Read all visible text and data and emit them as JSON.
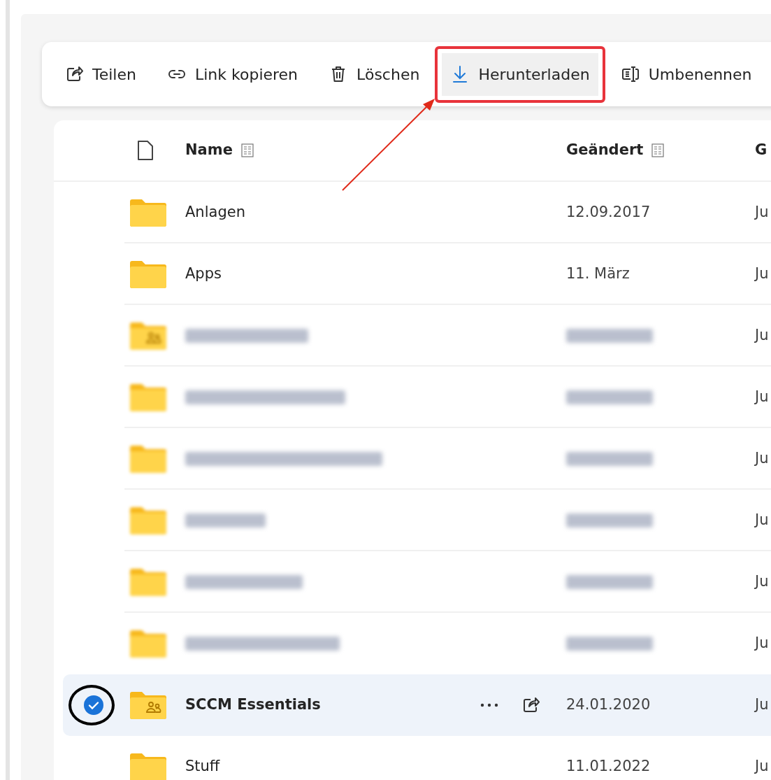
{
  "toolbar": [
    {
      "kind": "share",
      "label": "Teilen",
      "hovered": false,
      "annotated": false
    },
    {
      "kind": "link",
      "label": "Link kopieren",
      "hovered": false,
      "annotated": false
    },
    {
      "kind": "delete",
      "label": "Löschen",
      "hovered": false,
      "annotated": false
    },
    {
      "kind": "download",
      "label": "Herunterladen",
      "hovered": true,
      "annotated": true
    },
    {
      "kind": "rename",
      "label": "Umbenennen",
      "hovered": false,
      "annotated": false
    }
  ],
  "table": {
    "columns": [
      "Name",
      "Geändert",
      "G"
    ],
    "rows": [
      {
        "kind": "folder",
        "name": "Anlagen",
        "modified": "12.09.2017",
        "column_3": "Ju",
        "selected": false,
        "redacted": false,
        "circled": false
      },
      {
        "kind": "folder",
        "name": "Apps",
        "modified": "11. März",
        "column_3": "Ju",
        "selected": false,
        "redacted": false,
        "circled": false
      },
      {
        "kind": "shared-folder",
        "column_3": "Ju",
        "selected": false,
        "redacted": true,
        "circled": false
      },
      {
        "kind": "folder",
        "column_3": "Ju",
        "selected": false,
        "redacted": true,
        "circled": false
      },
      {
        "kind": "folder",
        "column_3": "Ju",
        "selected": false,
        "redacted": true,
        "circled": false
      },
      {
        "kind": "folder",
        "column_3": "Ju",
        "selected": false,
        "redacted": true,
        "circled": false
      },
      {
        "kind": "folder",
        "column_3": "Ju",
        "selected": false,
        "redacted": true,
        "circled": false
      },
      {
        "kind": "folder",
        "column_3": "Ju",
        "selected": false,
        "redacted": true,
        "circled": false
      },
      {
        "kind": "shared-folder",
        "name": "SCCM Essentials",
        "modified": "24.01.2020",
        "column_3": "Ju",
        "selected": true,
        "redacted": false,
        "circled": true
      },
      {
        "kind": "folder",
        "name": "Stuff",
        "modified": "11.01.2022",
        "column_3": "Ju",
        "selected": false,
        "redacted": false,
        "circled": false
      }
    ]
  },
  "annotations": [
    {
      "kind": "arrow"
    }
  ]
}
